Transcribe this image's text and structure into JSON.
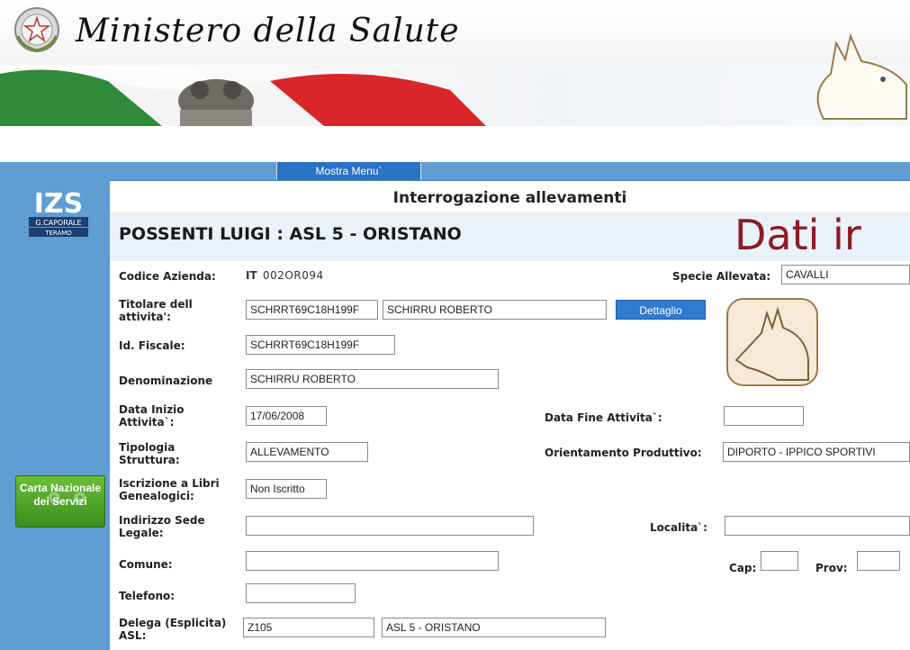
{
  "header": {
    "title": "Ministero della Salute"
  },
  "menu": {
    "show_menu": "Mostra Menu`"
  },
  "sidebar": {
    "logo_text": "IZS",
    "logo_sub1": "G.CAPORALE",
    "logo_sub2": "TERAMO",
    "cns_line1": "Carta Nazionale",
    "cns_line2": "dei Servizi"
  },
  "page": {
    "title": "Interrogazione allevamenti",
    "company": "POSSENTI LUIGI : ASL 5 - ORISTANO",
    "dati_text": "Dati ir"
  },
  "form": {
    "codice_azienda_label": "Codice Azienda:",
    "codice_azienda_prefix": "IT",
    "codice_azienda_value": "002OR094",
    "specie_label": "Specie Allevata:",
    "specie_value": "CAVALLI",
    "titolare_label": "Titolare dell attivita':",
    "titolare_cf": "SCHRRT69C18H199F",
    "titolare_nome": "SCHIRRU ROBERTO",
    "dettaglio_label": "Dettaglio",
    "id_fiscale_label": "Id. Fiscale:",
    "id_fiscale_value": "SCHRRT69C18H199F",
    "denominazione_label": "Denominazione",
    "denominazione_value": "SCHIRRU ROBERTO",
    "data_inizio_label": "Data Inizio Attivita`:",
    "data_inizio_value": "17/06/2008",
    "data_fine_label": "Data Fine Attivita`:",
    "data_fine_value": "",
    "tipologia_label": "Tipologia Struttura:",
    "tipologia_value": "ALLEVAMENTO",
    "orientamento_label": "Orientamento Produttivo:",
    "orientamento_value": "DIPORTO - IPPICO SPORTIVI",
    "iscrizione_label": "Iscrizione a Libri Genealogici:",
    "iscrizione_value": "Non Iscritto",
    "indirizzo_label": "Indirizzo Sede Legale:",
    "indirizzo_value": "",
    "localita_label": "Localita`:",
    "localita_value": "",
    "comune_label": "Comune:",
    "comune_value": "",
    "cap_label": "Cap:",
    "cap_value": "",
    "prov_label": "Prov:",
    "prov_value": "",
    "telefono_label": "Telefono:",
    "telefono_value": "",
    "delega_label": "Delega (Esplicita) ASL:",
    "delega_code": "Z105",
    "delega_name": "ASL 5 - ORISTANO"
  },
  "icons": [
    "home-back-icon",
    "home-icon",
    "users-icon",
    "logout-icon"
  ],
  "colors": {
    "sidebar_blue": "#5f9dd2",
    "button_blue": "#2f7bd0",
    "title_red": "#8b1c24",
    "cns_green": "#4aa02a"
  }
}
